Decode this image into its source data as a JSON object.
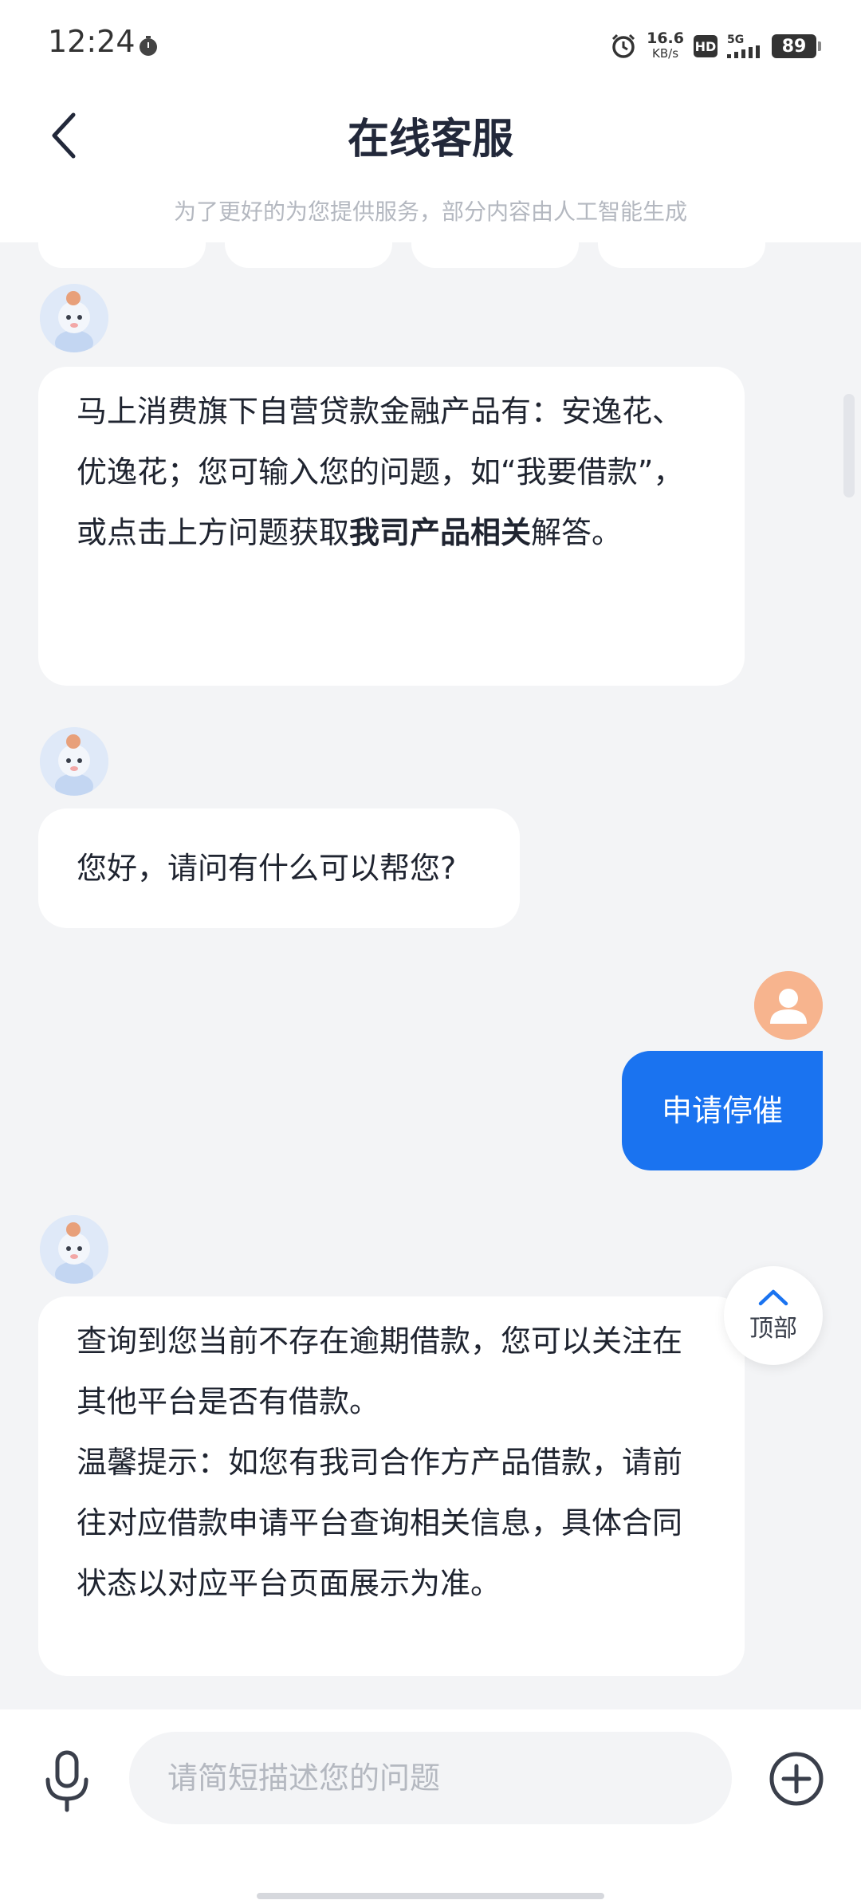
{
  "status_bar": {
    "time": "12:24",
    "speed_value": "16.6",
    "speed_unit": "KB/s",
    "hd": "HD",
    "network": "5G",
    "battery": "89"
  },
  "header": {
    "title": "在线客服",
    "subtitle": "为了更好的为您提供服务，部分内容由人工智能生成"
  },
  "messages": [
    {
      "from": "bot",
      "text_before": "马上消费旗下自营贷款金融产品有：安逸花、优逸花；您可输入您的问题，如“我要借款”，或点击上方问题获取",
      "bold": "我司产品相关",
      "text_after": "解答。"
    },
    {
      "from": "bot",
      "text": "您好，请问有什么可以帮您?"
    },
    {
      "from": "user",
      "text": "申请停催"
    },
    {
      "from": "bot",
      "line1": "查询到您当前不存在逾期借款，您可以关注在其他平台是否有借款。",
      "line2": "温馨提示：如您有我司合作方产品借款，请前往对应借款申请平台查询相关信息，具体合同状态以对应平台页面展示为准。"
    }
  ],
  "top_button": {
    "label": "顶部"
  },
  "input": {
    "placeholder": "请简短描述您的问题",
    "value": ""
  },
  "icons": {
    "back": "back-arrow-icon",
    "mic": "microphone-icon",
    "plus": "plus-circle-icon",
    "alarm": "alarm-icon",
    "timer": "timer-icon",
    "scroll_top": "chevron-up-icon"
  },
  "colors": {
    "accent": "#1a73f0",
    "background": "#f3f4f6",
    "user_avatar": "#f7b48e"
  }
}
